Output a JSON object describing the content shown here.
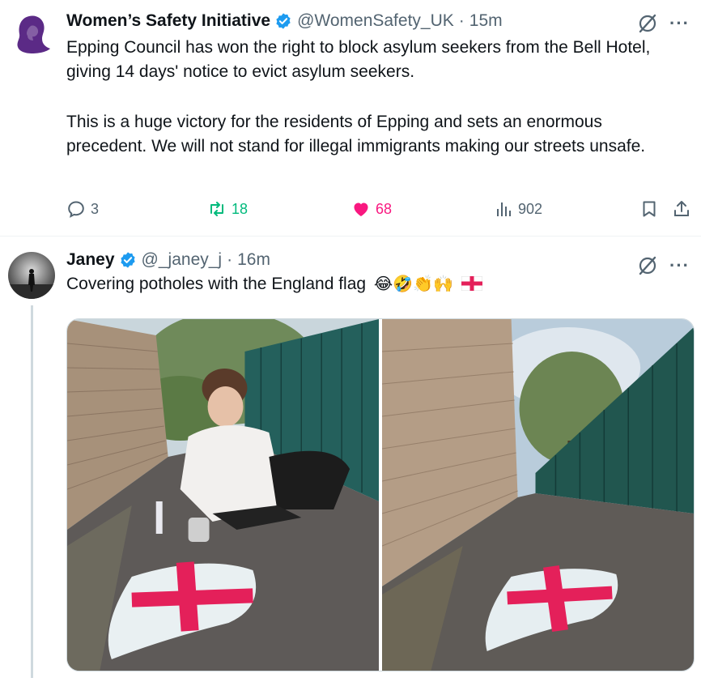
{
  "tweets": [
    {
      "display_name": "Women’s Safety Initiative",
      "handle": "@WomenSafety_UK",
      "separator": "·",
      "time": "15m",
      "paragraphs": [
        "Epping Council has won the right to block asylum seekers from the Bell Hotel, giving 14 days' notice to evict asylum seekers.",
        "This is a huge victory for the residents of Epping and sets an enormous precedent. We will not stand for illegal immigrants making our streets unsafe."
      ],
      "stats": {
        "replies": "3",
        "retweets": "18",
        "likes": "68",
        "views": "902"
      }
    },
    {
      "display_name": "Janey",
      "handle": "@_janey_j",
      "separator": "·",
      "time": "16m",
      "text": "Covering potholes with the England flag",
      "emojis": "😂🤣👏🙌",
      "flag_icon": "england-flag-icon"
    }
  ],
  "more_label": "···",
  "colors": {
    "verified": "#1d9bf0",
    "retweet": "#00ba7c",
    "like": "#f91880",
    "muted": "#536471",
    "flag_red": "#e4205a"
  }
}
